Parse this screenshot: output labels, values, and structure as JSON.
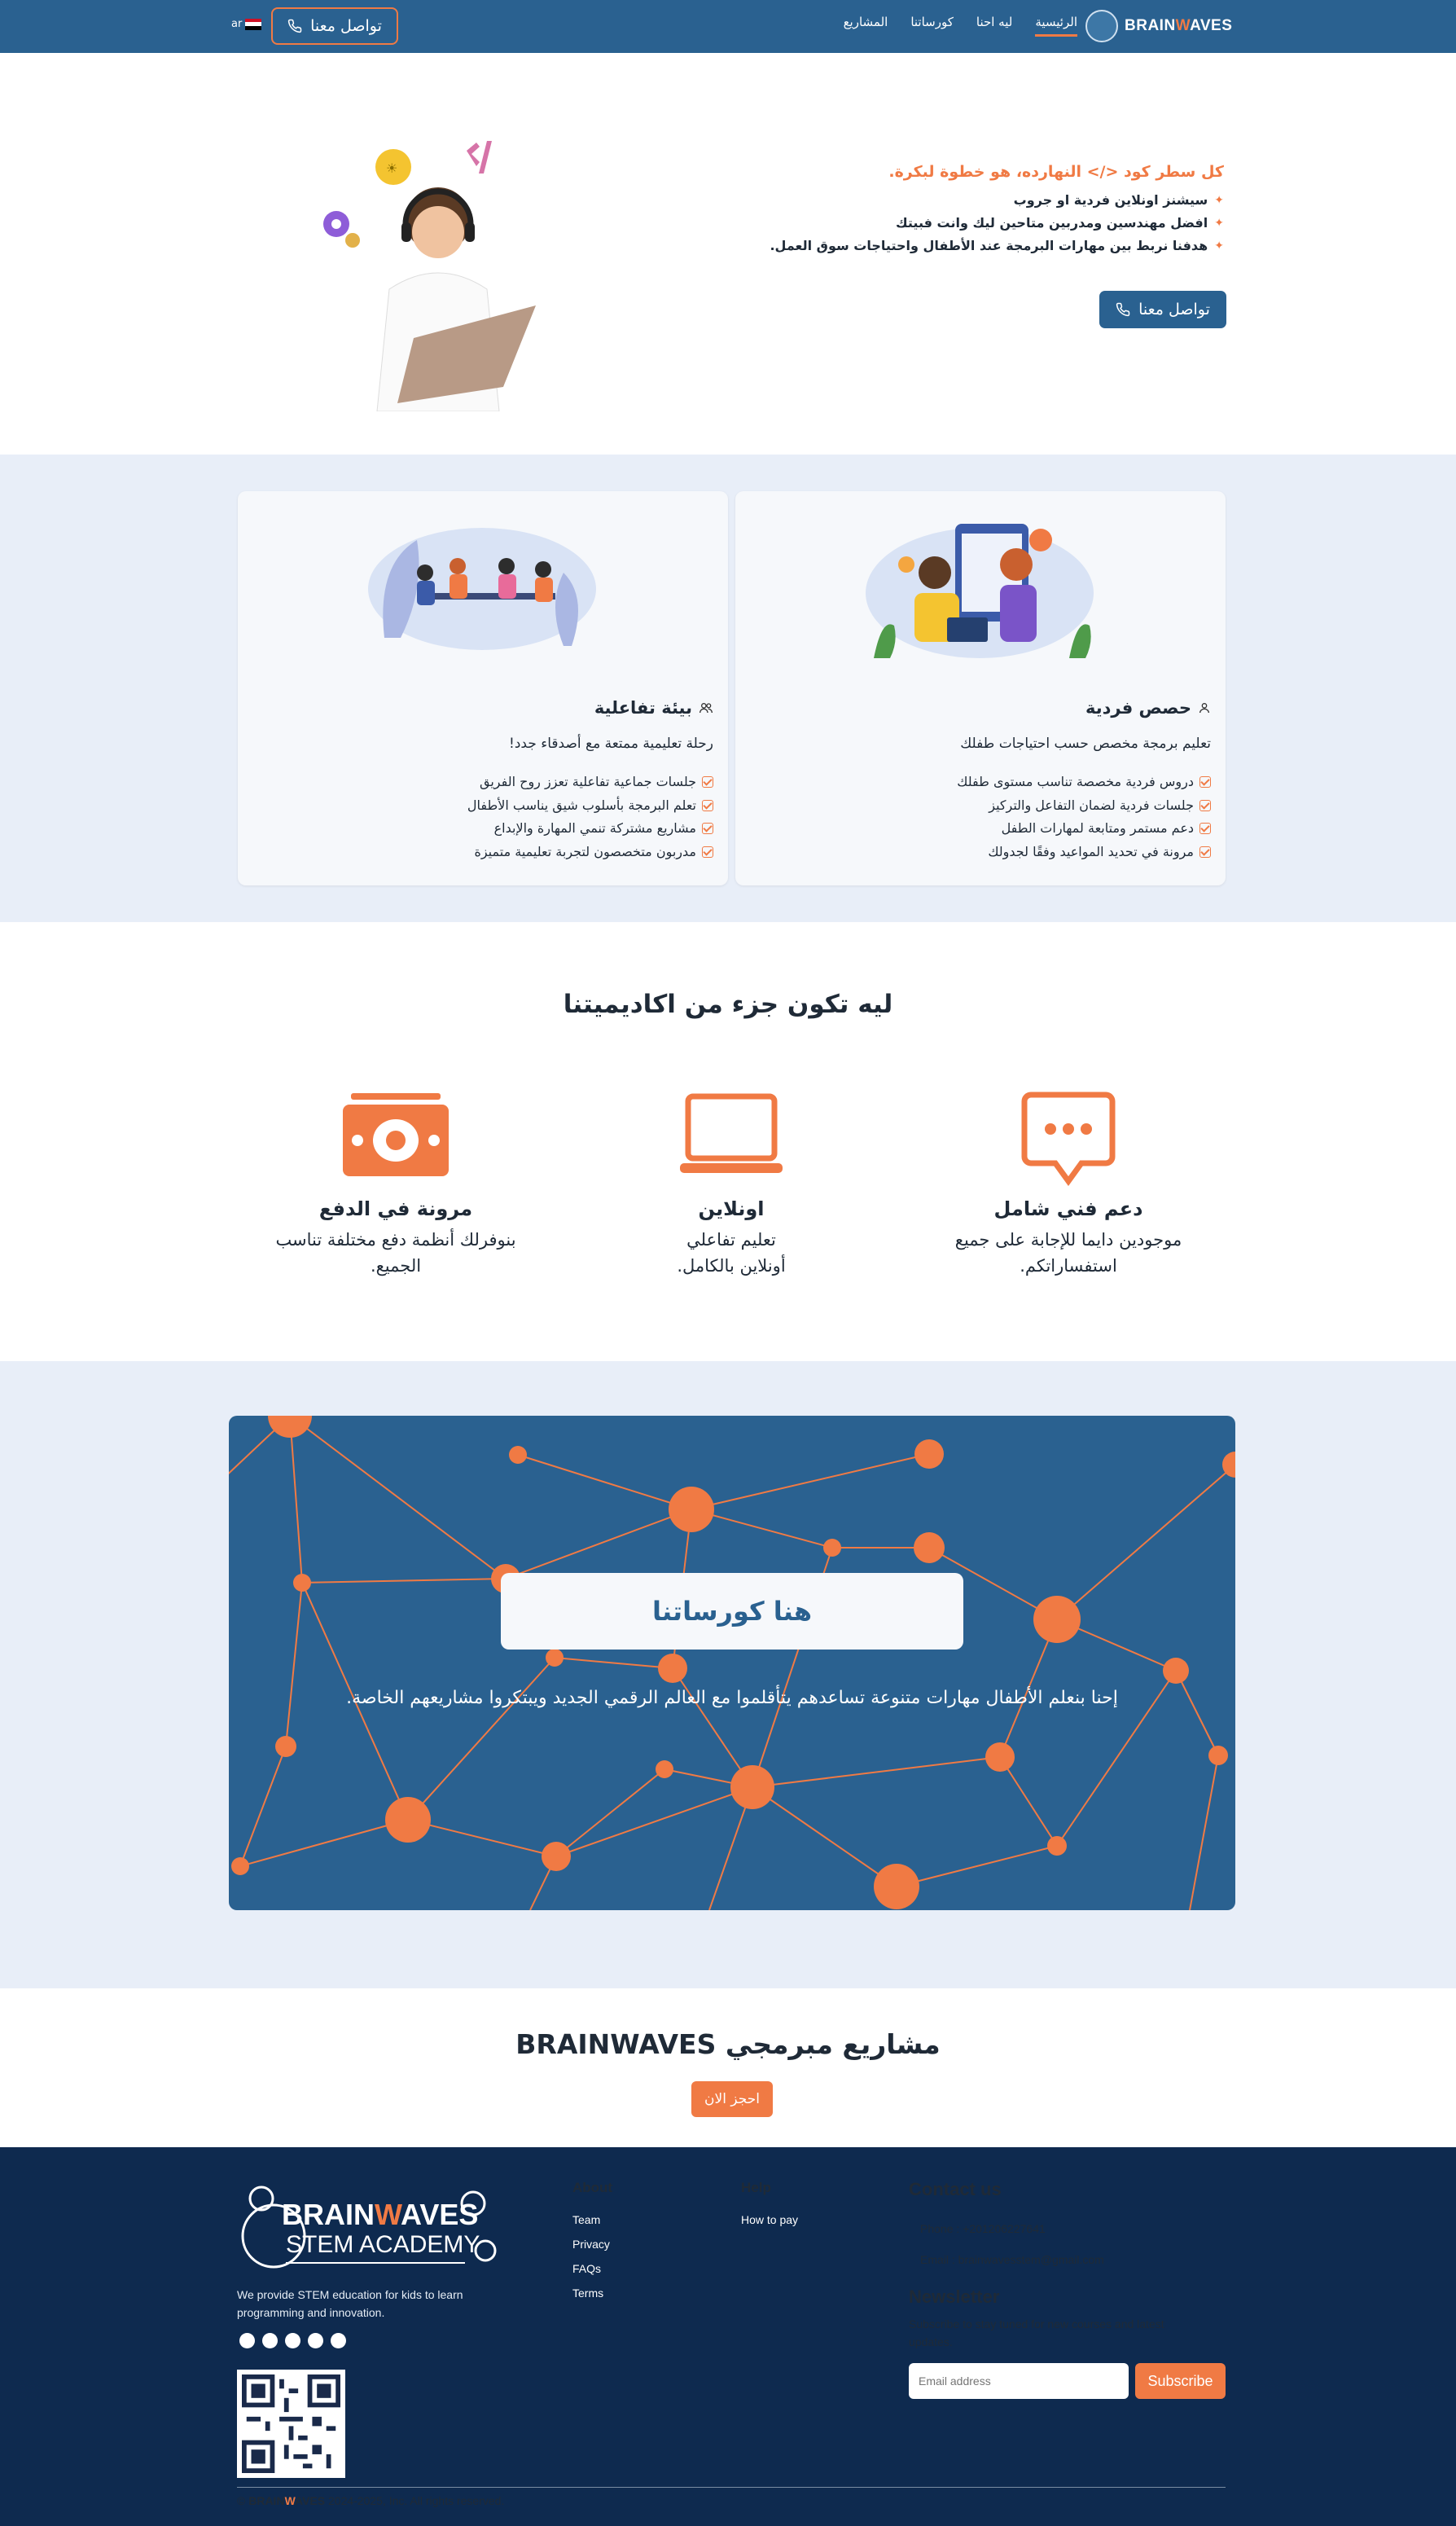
{
  "nav": {
    "brand": {
      "part1": "BRAIN",
      "accent": "W",
      "part2": "AVES"
    },
    "links": [
      "الرئيسية",
      "ليه احنا",
      "كورساتنا",
      "المشاريع"
    ],
    "cta": "تواصل معنا",
    "lang": "ar"
  },
  "hero": {
    "title": "كل سطر كود </> النهارده، هو خطوة لبكرة.",
    "points": [
      "سيشنز اونلاين فردية او جروب",
      "افضل مهندسين ومدربين متاحين ليك وانت فبيتك",
      "هدفنا نربط بين مهارات البرمجة عند الأطفال واحتياجات سوق العمل."
    ],
    "cta": "تواصل معنا"
  },
  "cards": [
    {
      "title": "حصص فردية",
      "subtitle": "تعليم برمجة مخصص حسب احتياجات طفلك",
      "items": [
        "دروس فردية مخصصة تناسب مستوى طفلك",
        "جلسات فردية لضمان التفاعل والتركيز",
        "دعم مستمر ومتابعة لمهارات الطفل",
        "مرونة في تحديد المواعيد وفقًا لجدولك"
      ]
    },
    {
      "title": "بيئة تفاعلية",
      "subtitle": "رحلة تعليمية ممتعة مع أصدقاء جدد!",
      "items": [
        "جلسات جماعية تفاعلية تعزز روح الفريق",
        "تعلم البرمجة بأسلوب شيق يناسب الأطفال",
        "مشاريع مشتركة تنمي المهارة والإبداع",
        "مدربون متخصصون لتجربة تعليمية متميزة"
      ]
    }
  ],
  "why": {
    "title": "ليه تكون جزء من اكاديميتنا",
    "items": [
      {
        "title": "دعم فني شامل",
        "text": "موجودين دايما للإجابة على جميع استفساراتكم."
      },
      {
        "title": "اونلاين",
        "text": "تعليم تفاعلي أونلاين بالكامل."
      },
      {
        "title": "مرونة في الدفع",
        "text": "بنوفرلك أنظمة دفع مختلفة تناسب الجميع."
      }
    ]
  },
  "courses": {
    "title": "هنا كورساتنا",
    "text": "إحنا بنعلم الأطفال مهارات متنوعة تساعدهم يتأقلموا مع العالم الرقمي الجديد ويبتكروا مشاريعهم الخاصة."
  },
  "projects": {
    "title": "مشاريع مبرمجي BRAINWAVES",
    "cta": "احجز الان"
  },
  "footer": {
    "logo_text": {
      "part1": "BRAIN",
      "accent": "W",
      "part2": "AVES",
      "line2": "STEM ACADEMY"
    },
    "description": "We provide STEM education for kids to learn programming and innovation.",
    "about": {
      "title": "About",
      "links": [
        "Team",
        "Privacy",
        "FAQs",
        "Terms"
      ]
    },
    "help": {
      "title": "Help",
      "links": [
        "How to pay"
      ]
    },
    "contact": {
      "title": "Contact us",
      "phone": "Phone : +201206227641",
      "email": "Email : brainwavesstem@gmail.com"
    },
    "newsletter": {
      "title": "Newsletter",
      "text": "Subscribe to stay tuned for new courses and latest updates.",
      "placeholder": "Email address",
      "button": "Subscribe"
    },
    "copyright": {
      "prefix": "©",
      "part1": "BRAIN",
      "accent": "W",
      "part2": "AVES",
      "suffix": "2024-2025, Inc. All rights reserved."
    }
  },
  "colors": {
    "primary": "#2a6190",
    "accent": "#f07a44",
    "footer": "#0e2a4f",
    "section_bg": "#e8eef8"
  }
}
